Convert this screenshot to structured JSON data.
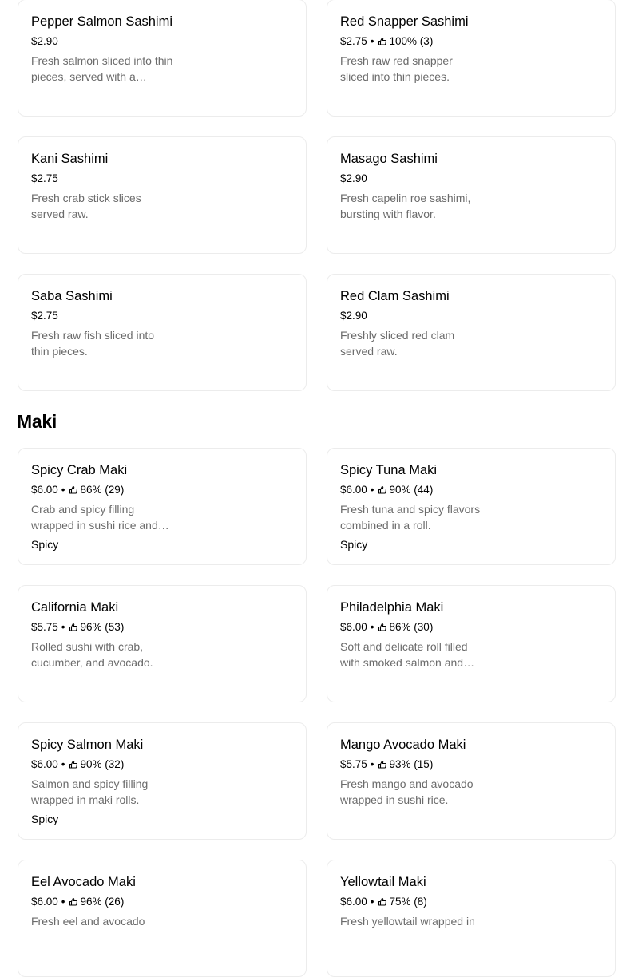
{
  "sashimi": {
    "items": [
      {
        "name": "Pepper Salmon Sashimi",
        "price": "$2.90",
        "rating": "",
        "desc": "Fresh salmon sliced into thin pieces, served with a…",
        "tag": ""
      },
      {
        "name": "Red Snapper Sashimi",
        "price": "$2.75",
        "rating": "100% (3)",
        "desc": "Fresh raw red snapper sliced into thin pieces.",
        "tag": ""
      },
      {
        "name": "Kani Sashimi",
        "price": "$2.75",
        "rating": "",
        "desc": "Fresh crab stick slices served raw.",
        "tag": ""
      },
      {
        "name": "Masago Sashimi",
        "price": "$2.90",
        "rating": "",
        "desc": "Fresh capelin roe sashimi, bursting with flavor.",
        "tag": ""
      },
      {
        "name": "Saba Sashimi",
        "price": "$2.75",
        "rating": "",
        "desc": "Fresh raw fish sliced into thin pieces.",
        "tag": ""
      },
      {
        "name": "Red Clam Sashimi",
        "price": "$2.90",
        "rating": "",
        "desc": "Freshly sliced red clam served raw.",
        "tag": ""
      }
    ]
  },
  "maki": {
    "title": "Maki",
    "items": [
      {
        "name": "Spicy Crab Maki",
        "price": "$6.00",
        "rating": "86% (29)",
        "desc": "Crab and spicy filling wrapped in sushi rice and…",
        "tag": "Spicy"
      },
      {
        "name": "Spicy Tuna Maki",
        "price": "$6.00",
        "rating": "90% (44)",
        "desc": "Fresh tuna and spicy flavors combined in a roll.",
        "tag": "Spicy"
      },
      {
        "name": "California Maki",
        "price": "$5.75",
        "rating": "96% (53)",
        "desc": "Rolled sushi with crab, cucumber, and avocado.",
        "tag": ""
      },
      {
        "name": "Philadelphia Maki",
        "price": "$6.00",
        "rating": "86% (30)",
        "desc": "Soft and delicate roll filled with smoked salmon and…",
        "tag": ""
      },
      {
        "name": "Spicy Salmon Maki",
        "price": "$6.00",
        "rating": "90% (32)",
        "desc": "Salmon and spicy filling wrapped in maki rolls.",
        "tag": "Spicy"
      },
      {
        "name": "Mango Avocado Maki",
        "price": "$5.75",
        "rating": "93% (15)",
        "desc": "Fresh mango and avocado wrapped in sushi rice.",
        "tag": ""
      },
      {
        "name": "Eel Avocado Maki",
        "price": "$6.00",
        "rating": "96% (26)",
        "desc": "Fresh eel and avocado",
        "tag": ""
      },
      {
        "name": "Yellowtail Maki",
        "price": "$6.00",
        "rating": "75% (8)",
        "desc": "Fresh yellowtail wrapped in",
        "tag": ""
      }
    ]
  },
  "icons": {
    "rating": "thumbs-up-icon"
  },
  "colors": {
    "text": "#000000",
    "muted": "#6b6b6b",
    "border": "#ececec"
  }
}
